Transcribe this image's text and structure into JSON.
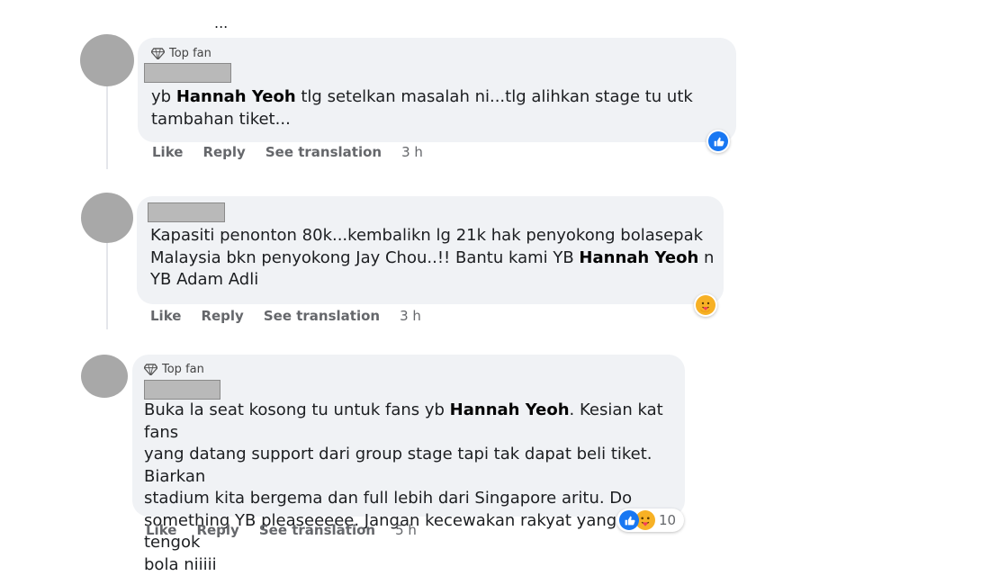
{
  "top_fragment": "...",
  "comments": [
    {
      "badge": "Top fan",
      "t1": "yb ",
      "b1": "Hannah Yeoh",
      "t2": " tlg setelkan masalah ni...tlg alihkan stage tu utk",
      "t3": "tambahan tiket...",
      "actions": {
        "like": "Like",
        "reply": "Reply",
        "translate": "See translation",
        "time": "3 h"
      },
      "reactions": [
        "like"
      ]
    },
    {
      "l1": "Kapasiti penonton 80k...kembalikn lg 21k hak penyokong bolasepak",
      "l2a": "Malaysia bkn penyokong Jay Chou..!! Bantu kami YB ",
      "l2b": "Hannah Yeoh",
      "l2c": " n",
      "l3": "YB Adam Adli",
      "actions": {
        "like": "Like",
        "reply": "Reply",
        "translate": "See translation",
        "time": "3 h"
      },
      "reactions": [
        "care"
      ]
    },
    {
      "badge": "Top fan",
      "l1a": "Buka la seat kosong tu untuk fans yb ",
      "l1b": "Hannah Yeoh",
      "l1c": ". Kesian kat fans",
      "l2": "yang datang support dari group stage tapi tak dapat beli tiket. Biarkan",
      "l3": "stadium kita bergema dan full lebih dari Singapore aritu. Do",
      "l4": "something YB pleaseeeee. Jangan kecewakan rakyat yang nak tengok",
      "l5": "bola niiiii",
      "actions": {
        "like": "Like",
        "reply": "Reply",
        "translate": "See translation",
        "time": "5 h"
      },
      "reactions": [
        "like",
        "care"
      ],
      "reaction_count": "10"
    }
  ],
  "colors": {
    "bubble": "#f0f2f5",
    "like_blue": "#1877f2",
    "care_yellow": "#f7b125",
    "meta_gray": "#65676b"
  }
}
